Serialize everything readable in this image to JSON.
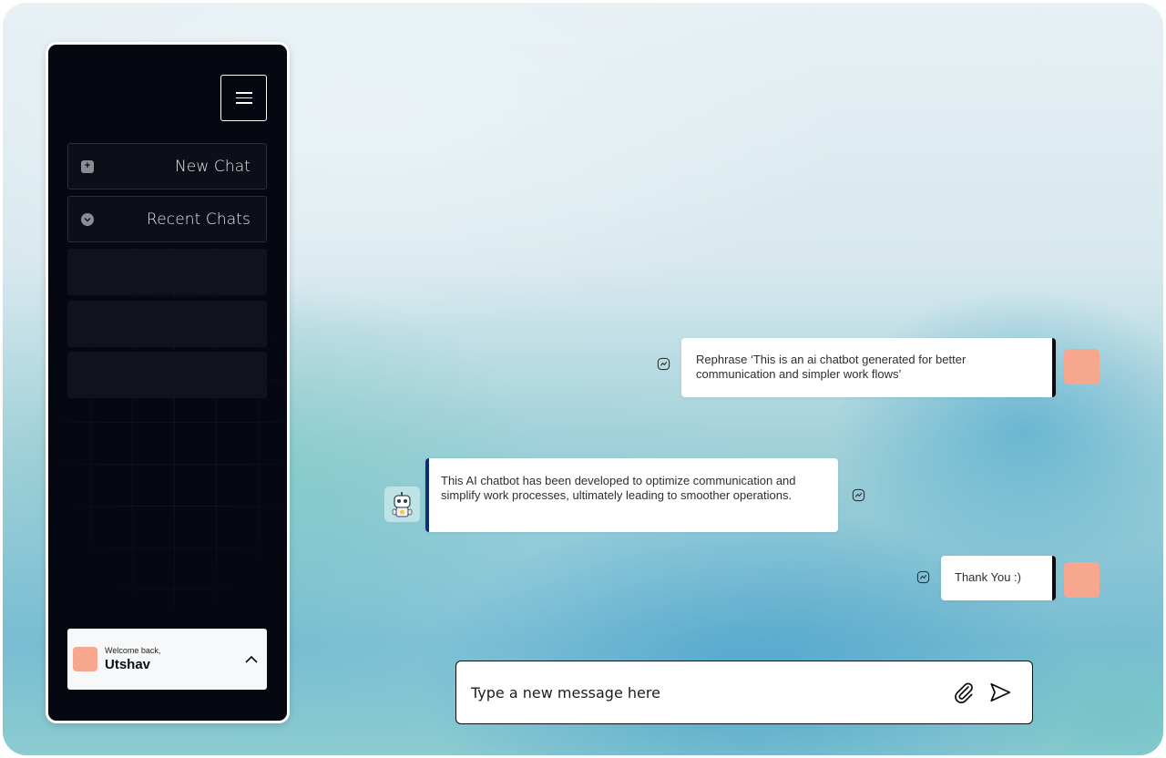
{
  "sidebar": {
    "new_chat_label": "New Chat",
    "recent_chats_label": "Recent Chats",
    "user": {
      "welcome_text": "Welcome back,",
      "name": "Utshav"
    }
  },
  "messages": [
    {
      "role": "user",
      "text": "Rephrase ‘This is an ai chatbot generated for better communication and simpler work flows’"
    },
    {
      "role": "bot",
      "text": "This AI chatbot has been developed to optimize communication and simplify work processes, ultimately leading to smoother operations."
    },
    {
      "role": "user",
      "text": "Thank You :)"
    }
  ],
  "composer": {
    "placeholder": "Type a new message here"
  },
  "colors": {
    "sidebar_bg": "#050810",
    "avatar_user": "#f8a78f",
    "bot_accent": "#0e2d73"
  },
  "icons": {
    "menu": "hamburger-icon",
    "new_chat": "plus-square-icon",
    "recent": "chevron-down-circle-icon",
    "user_expand": "chevron-up-icon",
    "reaction": "react-icon",
    "attach": "paperclip-icon",
    "send": "send-icon"
  }
}
